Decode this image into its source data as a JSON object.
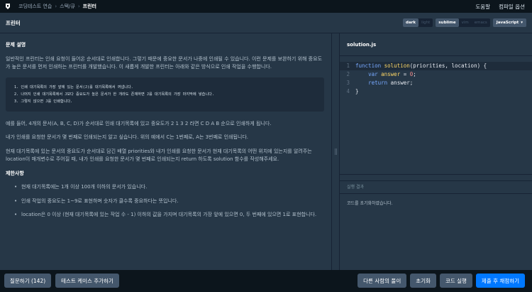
{
  "topbar": {
    "breadcrumbs": [
      "코딩테스트 연습",
      "스택/큐",
      "프린터"
    ],
    "links": [
      "도움말",
      "컴파일 옵션"
    ]
  },
  "titlebar": {
    "title": "프린터",
    "theme": [
      "dark",
      "light"
    ],
    "keymap": [
      "sublime",
      "vim",
      "emacs"
    ],
    "language": "JavaScript"
  },
  "problem": {
    "heading": "문제 설명",
    "intro": "일반적인 프린터는 인쇄 요청이 들어온 순서대로 인쇄합니다. 그렇기 때문에 중요한 문서가 나중에 인쇄될 수 있습니다. 이런 문제를 보완하기 위해 중요도가 높은 문서를 먼저 인쇄하는 프린터를 개발했습니다. 이 새롭게 개발한 프린터는 아래와 같은 방식으로 인쇄 작업을 수행합니다.",
    "steps": [
      "1. 인쇄 대기목록의 가장 앞에 있는 문서(J)를 대기목록에서 꺼냅니다.",
      "2. 나머지 인쇄 대기목록에서 J보다 중요도가 높은 문서가 한 개라도 존재하면 J를 대기목록의 가장 마지막에 넣습니다.",
      "3. 그렇지 않으면 J를 인쇄합니다."
    ],
    "example1": "예를 들어, 4개의 문서(A, B, C, D)가 순서대로 인쇄 대기목록에 있고 중요도가 2 1 3 2 라면 C D A B 순으로 인쇄하게 됩니다.",
    "example2": "내가 인쇄를 요청한 문서가 몇 번째로 인쇄되는지 알고 싶습니다. 위의 예에서 C는 1번째로, A는 3번째로 인쇄됩니다.",
    "task": "현재 대기목록에 있는 문서의 중요도가 순서대로 담긴 배열 priorities와 내가 인쇄를 요청한 문서가 현재 대기목록의 어떤 위치에 있는지를 알려주는 location이 매개변수로 주어질 때, 내가 인쇄를 요청한 문서가 몇 번째로 인쇄되는지 return 하도록 solution 함수를 작성해주세요.",
    "constraints_heading": "제한사항",
    "constraints": [
      "현재 대기목록에는 1개 이상 100개 이하의 문서가 있습니다.",
      "인쇄 작업의 중요도는 1~9로 표현하며 숫자가 클수록 중요하다는 뜻입니다.",
      "location은 0 이상 (현재 대기목록에 있는 작업 수 - 1) 이하의 값을 가지며 대기목록의 가장 앞에 있으면 0, 두 번째에 있으면 1로 표현합니다."
    ]
  },
  "editor": {
    "filename": "solution.js",
    "line_numbers": [
      "1",
      "2",
      "3",
      "4"
    ]
  },
  "result": {
    "heading": "실행 결과",
    "message": "코드를 초기화하였습니다."
  },
  "buttons": {
    "question": "질문하기 (142)",
    "add_testcase": "테스트 케이스 추가하기",
    "others": "다른 사람의 풀이",
    "reset": "초기화",
    "run": "코드 실행",
    "submit": "제출 후 채점하기"
  }
}
